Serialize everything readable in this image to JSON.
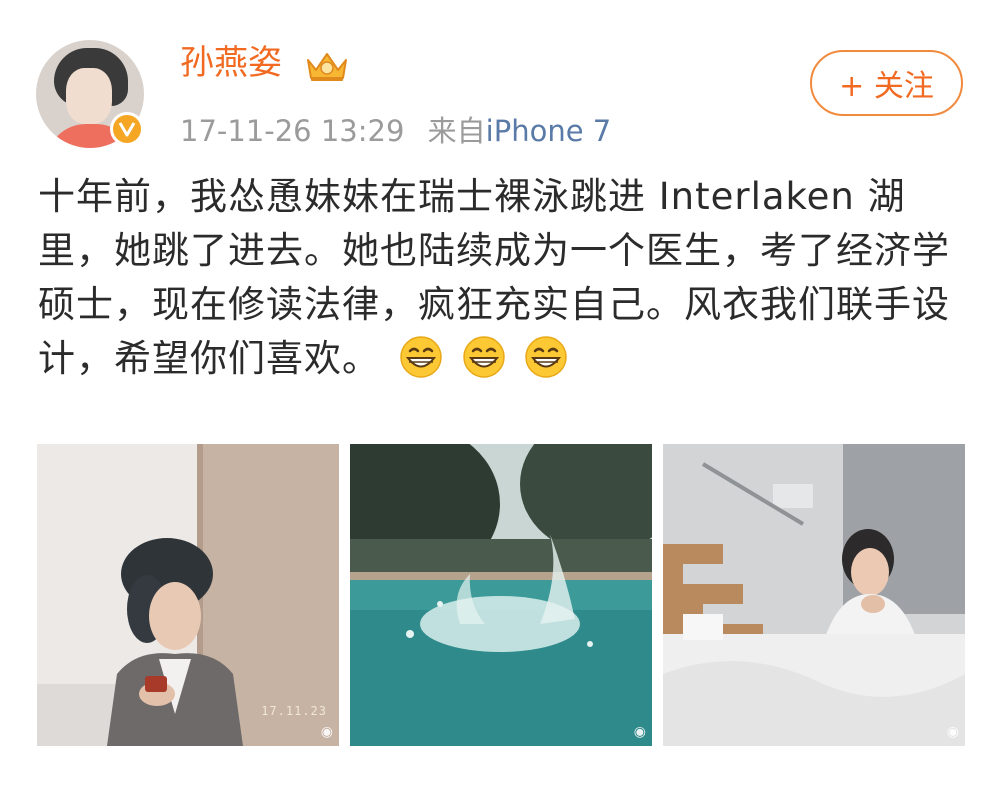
{
  "user": {
    "name": "孙燕姿",
    "avatar_icon": "avatar-portrait",
    "verified_icon": "verified-v-badge",
    "member_icon": "crown-icon"
  },
  "post_meta": {
    "timestamp": "17-11-26 13:29",
    "source_prefix": "来自",
    "device": "iPhone 7"
  },
  "follow_button": {
    "label": "+ 关注"
  },
  "content": {
    "text": "十年前，我怂恿妹妹在瑞士裸泳跳进 Interlaken 湖里，她跳了进去。她也陆续成为一个医生，考了经济学硕士，现在修读法律，疯狂充实自己。风衣我们联手设计，希望你们喜欢。",
    "emojis": [
      "grin-emoji",
      "grin-emoji",
      "grin-emoji"
    ]
  },
  "photos": [
    {
      "subject": "woman-with-towel-photo",
      "stamp": "17.11.23"
    },
    {
      "subject": "pool-splash-photo",
      "stamp": ""
    },
    {
      "subject": "woman-in-bed-photo",
      "stamp": ""
    }
  ],
  "colors": {
    "username": "#f26a21",
    "device_link": "#5a7aa8",
    "meta_gray": "#9b9b9b",
    "follow_border": "#f28a3e",
    "body_text": "#2b2b2b"
  }
}
